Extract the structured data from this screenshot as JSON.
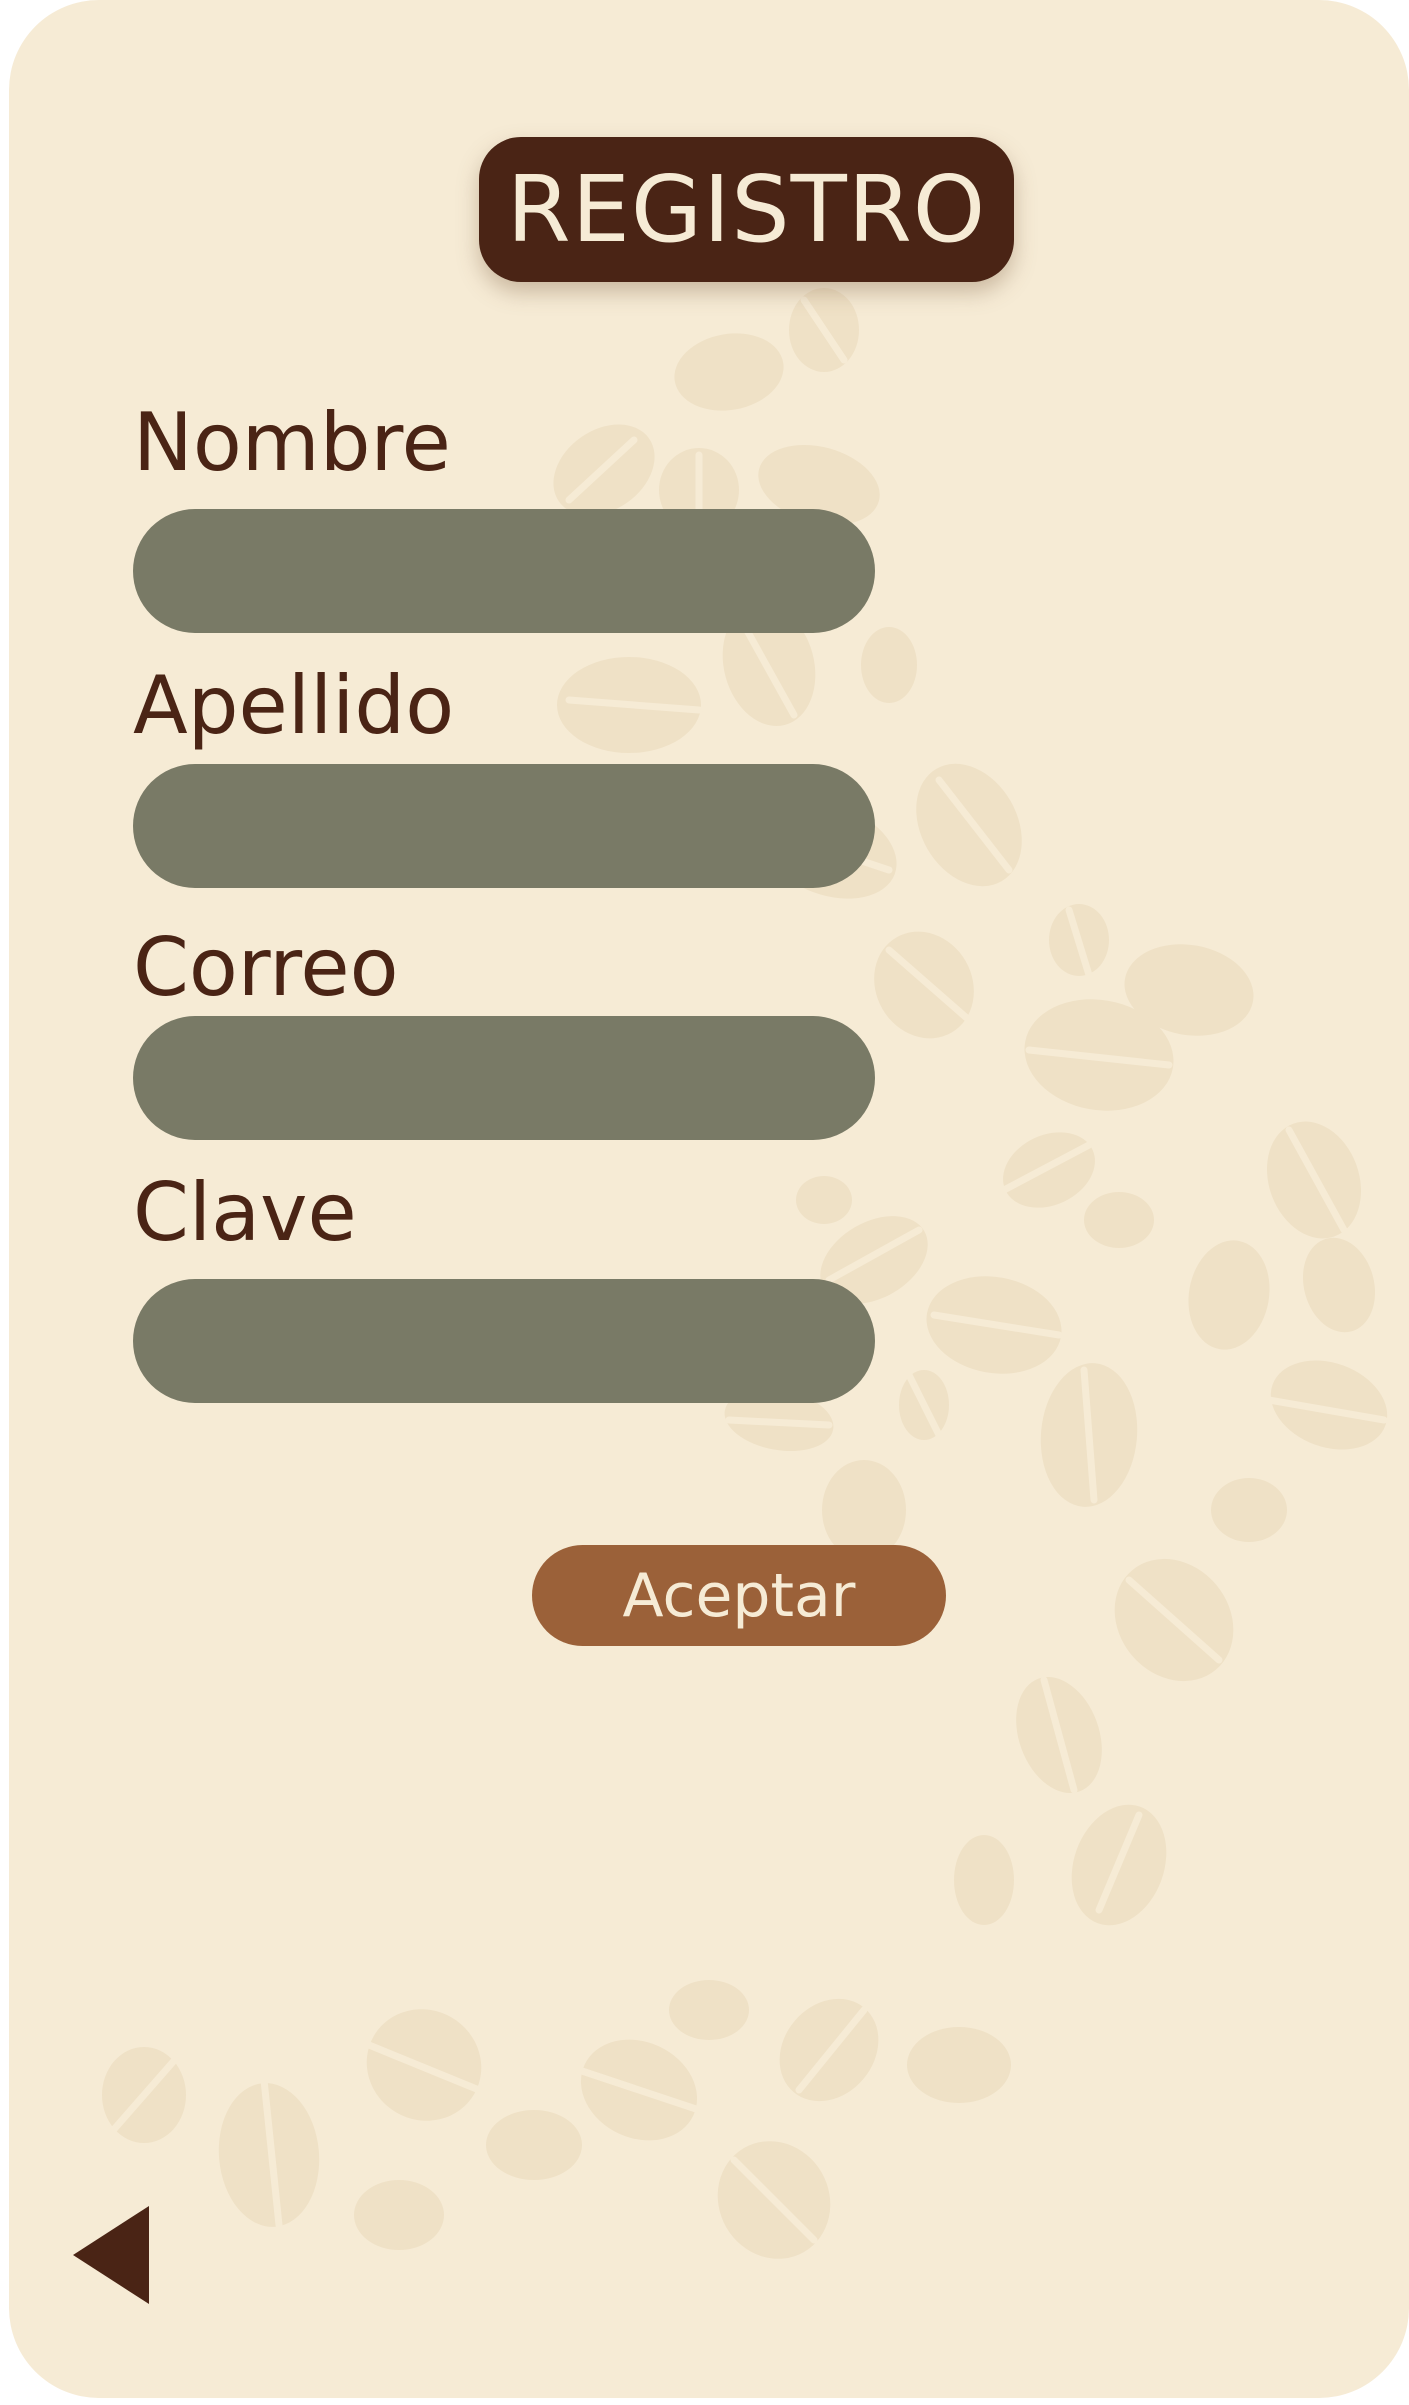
{
  "header": {
    "title": "REGISTRO"
  },
  "form": {
    "fields": [
      {
        "label": "Nombre",
        "value": ""
      },
      {
        "label": "Apellido",
        "value": ""
      },
      {
        "label": "Correo",
        "value": ""
      },
      {
        "label": "Clave",
        "value": ""
      }
    ],
    "submit_label": "Aceptar"
  },
  "navigation": {
    "back_icon": "triangle-left"
  },
  "colors": {
    "background": "#f6ebd5",
    "title_badge": "#4a2415",
    "label_text": "#4a2415",
    "input_fill": "#797a66",
    "submit_button": "#9b6139",
    "bean_pattern": "#efe1c6"
  }
}
